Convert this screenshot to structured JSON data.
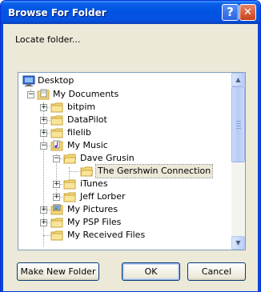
{
  "window": {
    "title": "Browse For Folder",
    "help_glyph": "?",
    "close_glyph": "✕"
  },
  "prompt": "Locate folder...",
  "tree": {
    "items": [
      {
        "label": "Desktop",
        "icon": "desktop-icon",
        "expander": ""
      },
      {
        "label": "My Documents",
        "icon": "documents-folder-icon",
        "expander": "−"
      },
      {
        "label": "bitpim",
        "icon": "folder-icon",
        "expander": "+"
      },
      {
        "label": "DataPilot",
        "icon": "folder-icon",
        "expander": "+"
      },
      {
        "label": "filelib",
        "icon": "folder-icon",
        "expander": "+"
      },
      {
        "label": "My Music",
        "icon": "music-folder-icon",
        "expander": "−"
      },
      {
        "label": "Dave Grusin",
        "icon": "folder-icon",
        "expander": "−"
      },
      {
        "label": "The Gershwin Connection",
        "icon": "folder-icon",
        "expander": "",
        "selected": true
      },
      {
        "label": "iTunes",
        "icon": "folder-icon",
        "expander": "+"
      },
      {
        "label": "Jeff Lorber",
        "icon": "folder-icon",
        "expander": "+"
      },
      {
        "label": "My Pictures",
        "icon": "pictures-folder-icon",
        "expander": "+"
      },
      {
        "label": "My PSP Files",
        "icon": "folder-icon",
        "expander": "+"
      },
      {
        "label": "My Received Files",
        "icon": "folder-icon",
        "expander": ""
      }
    ]
  },
  "scroll": {
    "up_glyph": "▲",
    "down_glyph": "▼"
  },
  "buttons": {
    "new_folder": "Make New Folder",
    "ok": "OK",
    "cancel": "Cancel"
  },
  "colors": {
    "title_bar": "#0054e3",
    "dialog_face": "#ece9d8",
    "tree_border": "#7f9db9",
    "selection": "#ece9d8"
  }
}
